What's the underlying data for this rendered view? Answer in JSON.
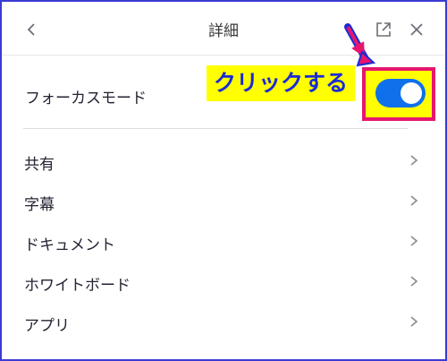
{
  "header": {
    "title": "詳細",
    "back_icon": "chevron-left-icon",
    "popout_icon": "external-link-icon",
    "close_icon": "close-icon"
  },
  "focus_mode": {
    "label": "フォーカスモード",
    "enabled": true,
    "toggle_color": "#0e71eb"
  },
  "annotation": {
    "text": "クリックする",
    "text_color": "#1a2bd6",
    "highlight_color": "#ffff00",
    "box_color": "#e6166e"
  },
  "menu": {
    "items": [
      {
        "label": "共有"
      },
      {
        "label": "字幕"
      },
      {
        "label": "ドキュメント"
      },
      {
        "label": "ホワイトボード"
      },
      {
        "label": "アプリ"
      }
    ],
    "chevron_icon": "chevron-right-icon"
  }
}
